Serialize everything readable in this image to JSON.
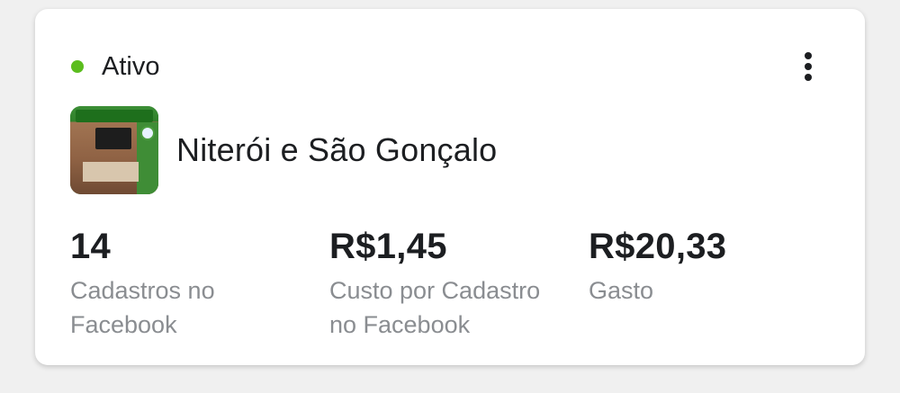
{
  "card": {
    "status": {
      "label": "Ativo",
      "color": "#5bbd1e"
    },
    "menu": {
      "icon": "more-vertical-icon"
    },
    "campaign": {
      "name": "Niterói e São Gonçalo",
      "thumbnail": "campaign-thumbnail-image"
    },
    "metrics": [
      {
        "value": "14",
        "label_line1": "Cadastros no",
        "label_line2": "Facebook"
      },
      {
        "value": "R$1,45",
        "label_line1": "Custo por Cadastro",
        "label_line2": "no Facebook"
      },
      {
        "value": "R$20,33",
        "label_line1": "Gasto",
        "label_line2": ""
      }
    ]
  }
}
